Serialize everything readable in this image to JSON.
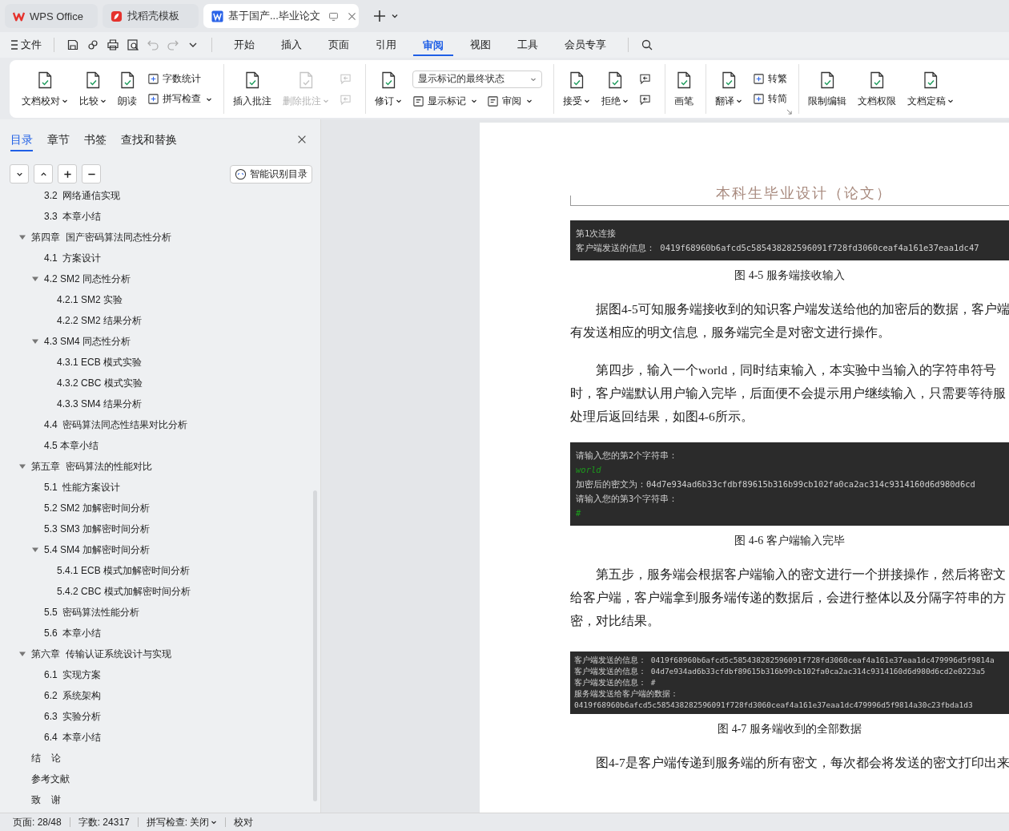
{
  "tabs": [
    {
      "kind": "home",
      "label": "WPS Office",
      "selected": false
    },
    {
      "kind": "templates",
      "label": "找稻壳模板",
      "selected": false
    },
    {
      "kind": "document",
      "label": "基于国产...毕业论文",
      "selected": true
    }
  ],
  "menu": {
    "file": "文件",
    "ribbon_tabs": [
      {
        "label": "开始",
        "selected": false
      },
      {
        "label": "插入",
        "selected": false
      },
      {
        "label": "页面",
        "selected": false
      },
      {
        "label": "引用",
        "selected": false
      },
      {
        "label": "审阅",
        "selected": true
      },
      {
        "label": "视图",
        "selected": false
      },
      {
        "label": "工具",
        "selected": false
      },
      {
        "label": "会员专享",
        "selected": false
      }
    ]
  },
  "toolbar": {
    "groups": [
      {
        "items": [
          {
            "kind": "big",
            "label": "文档校对",
            "dropdown": true,
            "disabled": false
          },
          {
            "kind": "big",
            "label": "比较",
            "dropdown": true,
            "disabled": false
          },
          {
            "kind": "big",
            "label": "朗读",
            "dropdown": false,
            "disabled": false
          },
          {
            "kind": "stack",
            "items": [
              {
                "kind": "small",
                "label": "字数统计",
                "dropdown": false,
                "disabled": false
              },
              {
                "kind": "small",
                "label": "拼写检查",
                "dropdown": true,
                "disabled": false
              }
            ]
          }
        ]
      },
      {
        "items": [
          {
            "kind": "big",
            "label": "插入批注",
            "dropdown": false,
            "disabled": false
          },
          {
            "kind": "big",
            "label": "删除批注",
            "dropdown": true,
            "disabled": true
          },
          {
            "kind": "stack",
            "items": [
              {
                "kind": "icon",
                "disabled": true
              },
              {
                "kind": "icon",
                "disabled": true
              }
            ]
          }
        ]
      },
      {
        "items": [
          {
            "kind": "big",
            "label": "修订",
            "dropdown": true,
            "disabled": false
          },
          {
            "kind": "stack",
            "items": [
              {
                "kind": "select",
                "value": "显示标记的最终状态"
              },
              {
                "kind": "pair",
                "items": [
                  {
                    "kind": "small",
                    "label": "显示标记",
                    "dropdown": true,
                    "disabled": false
                  },
                  {
                    "kind": "small",
                    "label": "审阅",
                    "dropdown": true,
                    "disabled": false
                  }
                ]
              }
            ]
          }
        ]
      },
      {
        "items": [
          {
            "kind": "big",
            "label": "接受",
            "dropdown": true,
            "disabled": false
          },
          {
            "kind": "big",
            "label": "拒绝",
            "dropdown": true,
            "disabled": false
          },
          {
            "kind": "stack",
            "items": [
              {
                "kind": "icon",
                "disabled": false
              },
              {
                "kind": "icon",
                "disabled": false
              }
            ]
          }
        ]
      },
      {
        "items": [
          {
            "kind": "big",
            "label": "画笔",
            "dropdown": false,
            "disabled": false
          }
        ]
      },
      {
        "items": [
          {
            "kind": "big",
            "label": "翻译",
            "dropdown": true,
            "disabled": false
          },
          {
            "kind": "stack",
            "items": [
              {
                "kind": "small",
                "label": "转繁",
                "dropdown": false,
                "disabled": false
              },
              {
                "kind": "small",
                "label": "转简",
                "dropdown": false,
                "disabled": false
              }
            ]
          },
          {
            "kind": "launcher"
          }
        ]
      },
      {
        "items": [
          {
            "kind": "big",
            "label": "限制编辑",
            "dropdown": false,
            "disabled": false
          },
          {
            "kind": "big",
            "label": "文档权限",
            "dropdown": false,
            "disabled": false
          },
          {
            "kind": "big",
            "label": "文档定稿",
            "dropdown": true,
            "disabled": false
          }
        ]
      }
    ]
  },
  "nav": {
    "tabs": [
      {
        "label": "目录",
        "selected": true
      },
      {
        "label": "章节",
        "selected": false
      },
      {
        "label": "书签",
        "selected": false
      },
      {
        "label": "查找和替换",
        "selected": false
      }
    ],
    "smart_button": "智能识别目录",
    "tree": {
      "continued_children": [
        {
          "label": "3.2  网络通信实现"
        },
        {
          "label": "3.3  本章小结"
        }
      ],
      "items": [
        {
          "label": "第四章  国产密码算法同态性分析",
          "expanded": true,
          "children": [
            {
              "label": "4.1  方案设计"
            },
            {
              "label": "4.2 SM2 同态性分析",
              "expanded": true,
              "children": [
                {
                  "label": "4.2.1 SM2 实验"
                },
                {
                  "label": "4.2.2 SM2 结果分析"
                }
              ]
            },
            {
              "label": "4.3 SM4 同态性分析",
              "expanded": true,
              "children": [
                {
                  "label": "4.3.1 ECB 模式实验"
                },
                {
                  "label": "4.3.2 CBC 模式实验"
                },
                {
                  "label": "4.3.3 SM4 结果分析"
                }
              ]
            },
            {
              "label": "4.4  密码算法同态性结果对比分析"
            },
            {
              "label": "4.5 本章小结"
            }
          ]
        },
        {
          "label": "第五章  密码算法的性能对比",
          "expanded": true,
          "children": [
            {
              "label": "5.1  性能方案设计"
            },
            {
              "label": "5.2 SM2 加解密时间分析"
            },
            {
              "label": "5.3 SM3 加解密时间分析"
            },
            {
              "label": "5.4 SM4 加解密时间分析",
              "expanded": true,
              "children": [
                {
                  "label": "5.4.1 ECB 模式加解密时间分析"
                },
                {
                  "label": "5.4.2 CBC 模式加解密时间分析"
                }
              ]
            },
            {
              "label": "5.5  密码算法性能分析"
            },
            {
              "label": "5.6  本章小结"
            }
          ]
        },
        {
          "label": "第六章  传输认证系统设计与实现",
          "expanded": true,
          "children": [
            {
              "label": "6.1  实现方案"
            },
            {
              "label": "6.2  系统架构"
            },
            {
              "label": "6.3  实验分析"
            },
            {
              "label": "6.4  本章小结"
            }
          ]
        },
        {
          "label": "结    论"
        },
        {
          "label": "参考文献"
        },
        {
          "label": "致    谢"
        }
      ]
    }
  },
  "document": {
    "header": "本科生毕业设计（论文）",
    "blocks": [
      {
        "kind": "console",
        "lines": [
          {
            "kind": "output",
            "text": "第1次连接"
          },
          {
            "kind": "output",
            "text": "客户端发送的信息： 0419f68960b6afcd5c585438282596091f728fd3060ceaf4a161e37eaa1dc47"
          }
        ]
      },
      {
        "kind": "caption",
        "text": "图 4-5  服务端接收输入"
      },
      {
        "kind": "paragraph",
        "lines": [
          "据图4-5可知服务端接收到的知识客户端发送给他的加密后的数据，客户端",
          "有发送相应的明文信息，服务端完全是对密文进行操作。"
        ]
      },
      {
        "kind": "paragraph",
        "lines": [
          "第四步，输入一个world，同时结束输入，本实验中当输入的字符串符号",
          "时，客户端默认用户输入完毕，后面便不会提示用户继续输入，只需要等待服",
          "处理后返回结果，如图4-6所示。"
        ]
      },
      {
        "kind": "console",
        "lines": [
          {
            "kind": "output",
            "text": "请输入您的第2个字符串："
          },
          {
            "kind": "input",
            "text": "world"
          },
          {
            "kind": "output",
            "text": "加密后的密文为：04d7e934ad6b33cfdbf89615b316b99cb102fa0ca2ac314c9314160d6d980d6cd"
          },
          {
            "kind": "output",
            "text": "请输入您的第3个字符串："
          },
          {
            "kind": "input",
            "text": "#"
          }
        ]
      },
      {
        "kind": "caption",
        "text": "图 4-6  客户端输入完毕"
      },
      {
        "kind": "paragraph",
        "lines": [
          "第五步，服务端会根据客户端输入的密文进行一个拼接操作，然后将密文",
          "给客户端，客户端拿到服务端传递的数据后，会进行整体以及分隔字符串的方",
          "密，对比结果。"
        ]
      },
      {
        "kind": "log",
        "lines": [
          {
            "kind": "output",
            "text": "客户端发送的信息： 0419f68960b6afcd5c585438282596091f728fd3060ceaf4a161e37eaa1dc479996d5f9814a"
          },
          {
            "kind": "output",
            "text": "客户端发送的信息： 04d7e934ad6b33cfdbf89615b316b99cb102fa0ca2ac314c9314160d6d980d6cd2e0223a5"
          },
          {
            "kind": "output",
            "text": "客户端发送的信息： #"
          },
          {
            "kind": "output",
            "text": "服务端发送给客户端的数据："
          },
          {
            "kind": "output",
            "text": "0419f68960b6afcd5c585438282596091f728fd3060ceaf4a161e37eaa1dc479996d5f9814a30c23fbda1d3"
          }
        ]
      },
      {
        "kind": "caption",
        "text": "图 4-7  服务端收到的全部数据"
      },
      {
        "kind": "paragraph",
        "lines": [
          "图4-7是客户端传递到服务端的所有密文，每次都会将发送的密文打印出来"
        ]
      }
    ]
  },
  "status_bar": [
    {
      "label": "页面: 28/48",
      "dropdown": false
    },
    {
      "label": "字数: 24317",
      "dropdown": false
    },
    {
      "label": "拼写检查: 关闭",
      "dropdown": true
    },
    {
      "label": "校对",
      "dropdown": false
    }
  ]
}
